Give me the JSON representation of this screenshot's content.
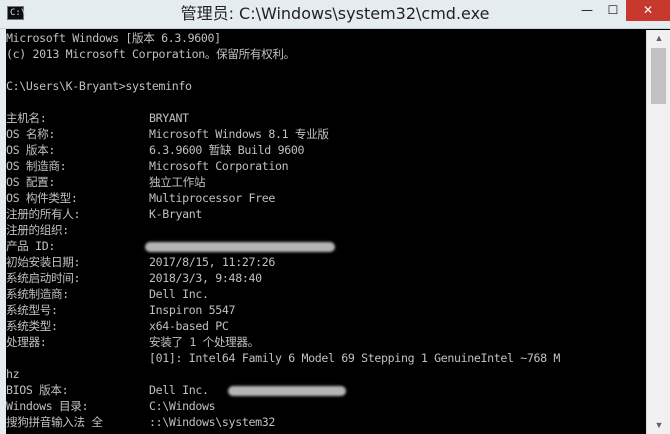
{
  "window": {
    "title": "管理员: C:\\Windows\\system32\\cmd.exe",
    "icon_text": "C:\\",
    "minimize_glyph": "—",
    "maximize_glyph": "☐",
    "close_glyph": "✕"
  },
  "scrollbar": {
    "up_glyph": "▲",
    "down_glyph": "▼"
  },
  "console": {
    "header": [
      "Microsoft Windows [版本 6.3.9600]",
      "(c) 2013 Microsoft Corporation。保留所有权利。"
    ],
    "command": "C:\\Users\\K-Bryant>systeminfo",
    "rows": [
      {
        "label": "主机名:",
        "value": "BRYANT"
      },
      {
        "label": "OS 名称:",
        "value": "Microsoft Windows 8.1 专业版"
      },
      {
        "label": "OS 版本:",
        "value": "6.3.9600 暂缺 Build 9600"
      },
      {
        "label": "OS 制造商:",
        "value": "Microsoft Corporation"
      },
      {
        "label": "OS 配置:",
        "value": "独立工作站"
      },
      {
        "label": "OS 构件类型:",
        "value": "Multiprocessor Free"
      },
      {
        "label": "注册的所有人:",
        "value": "K-Bryant"
      },
      {
        "label": "注册的组织:",
        "value": ""
      },
      {
        "label": "产品 ID:",
        "value": ""
      },
      {
        "label": "初始安装日期:",
        "value": "2017/8/15, 11:27:26"
      },
      {
        "label": "系统启动时间:",
        "value": "2018/3/3, 9:48:40"
      },
      {
        "label": "系统制造商:",
        "value": "Dell Inc."
      },
      {
        "label": "系统型号:",
        "value": "Inspiron 5547"
      },
      {
        "label": "系统类型:",
        "value": "x64-based PC"
      },
      {
        "label": "处理器:",
        "value": "安装了 1 个处理器。"
      },
      {
        "label": "",
        "value": "[01]: Intel64 Family 6 Model 69 Stepping 1 GenuineIntel ~768 M"
      },
      {
        "label": "hz",
        "value": ""
      },
      {
        "label": "BIOS 版本:",
        "value": "Dell Inc."
      },
      {
        "label": "Windows 目录:",
        "value": "C:\\Windows"
      },
      {
        "label": "搜狗拼音输入法 全",
        "value": "::\\Windows\\system32"
      }
    ]
  }
}
